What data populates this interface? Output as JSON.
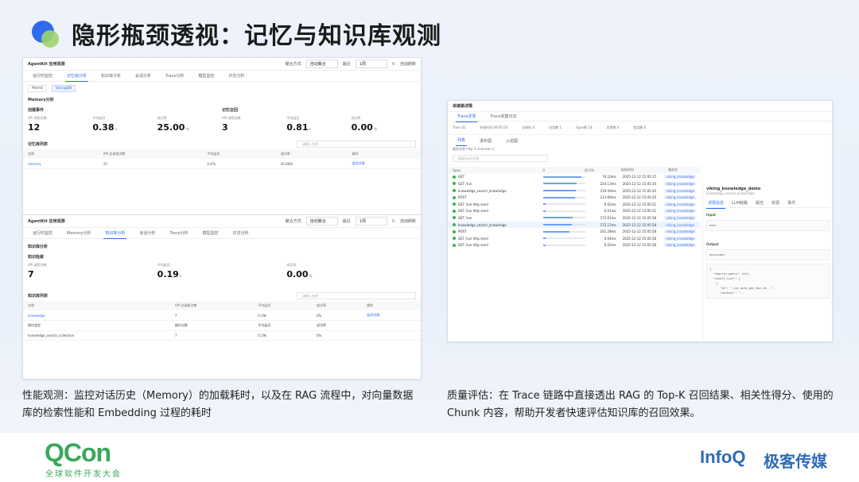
{
  "slide": {
    "title": "隐形瓶颈透视：记忆与知识库观测"
  },
  "panel1": {
    "app": "AgentKit 应用观测",
    "controls": {
      "agg_label": "聚合方式",
      "agg_value": "自动聚合",
      "range_label": "最近",
      "range_value": "1周",
      "refresh": "自动刷新"
    },
    "tabs": [
      "运行时监控",
      "记忆库分析",
      "知识库分析",
      "会话分析",
      "Trace分析",
      "模型监控",
      "日志分析"
    ],
    "subtabs": [
      "Mem0",
      "VikingDB"
    ],
    "section": "Memory分析",
    "groups": [
      {
        "title": "创建事件",
        "metrics": [
          {
            "label": "API 调用次数",
            "value": "12",
            "unit": ""
          },
          {
            "label": "平均延迟",
            "value": "0.38",
            "unit": "s"
          },
          {
            "label": "成功率",
            "value": "25.00",
            "unit": "%"
          }
        ]
      },
      {
        "title": "记忆召回",
        "metrics": [
          {
            "label": "API 调用次数",
            "value": "3",
            "unit": ""
          },
          {
            "label": "平均延迟",
            "value": "0.81",
            "unit": "s"
          },
          {
            "label": "成功率",
            "value": "0.00",
            "unit": "%"
          }
        ]
      }
    ],
    "list_title": "记忆库列表",
    "search_placeholder": "请输入名称",
    "table": {
      "headers": [
        "名称",
        "API 总调用次数",
        "平均延迟",
        "成功率",
        "操作"
      ],
      "rows": [
        [
          "memory",
          "15",
          "0.47s",
          "20.00%",
          "监控详情"
        ]
      ]
    }
  },
  "panel2": {
    "app": "AgentKit 应用观测",
    "controls": {
      "agg_label": "聚合方式",
      "agg_value": "自动聚合",
      "range_label": "最近",
      "range_value": "1周",
      "refresh": "自动刷新"
    },
    "tabs": [
      "运行时监控",
      "Memory分析",
      "知识库分析",
      "会话分析",
      "Trace分析",
      "模型监控",
      "日志分析"
    ],
    "section": "知识库分析",
    "group_title": "知识检索",
    "metrics": [
      {
        "label": "API 调用次数",
        "value": "7",
        "unit": ""
      },
      {
        "label": "平均延迟",
        "value": "0.19",
        "unit": "s"
      },
      {
        "label": "成功率",
        "value": "0.00",
        "unit": "%"
      }
    ],
    "list_title": "知识库列表",
    "search_placeholder": "请输入名称",
    "table": {
      "headers": [
        "名称",
        "API 总调用次数",
        "平均延迟",
        "成功率",
        "操作"
      ],
      "rows": [
        [
          "knowledge",
          "7",
          "0.19s",
          "0%",
          "监控详情"
        ],
        [
          "操作类型",
          "操作次数",
          "平均延迟",
          "成功率",
          ""
        ],
        [
          "knowledge_search_collection",
          "7",
          "0.19s",
          "0%",
          ""
        ]
      ]
    }
  },
  "panel3": {
    "title": "单链路详情",
    "tabs": [
      "Trace详情",
      "Trace完整日志"
    ],
    "info": [
      "Trace ID",
      "开始时间 08:00:50",
      "总耗时 4",
      "应用数 1",
      "Span数 18",
      "异常数 0",
      "错误数 0"
    ],
    "subtabs": [
      "列表",
      "瀑布图",
      "火焰图"
    ],
    "filters": "服务名称 http 3 unknown 2",
    "search_placeholder": "搜索Span名称",
    "header": [
      "Span",
      "0",
      "42.0%",
      "起始时间",
      "服务名"
    ],
    "rows": [
      {
        "name": "GET",
        "dur": "76.10ms",
        "ts": "2025-12-12 15:05:15",
        "svc": "viking_knowledge",
        "w": 0.9
      },
      {
        "name": "GET /run",
        "dur": "224.13ms",
        "ts": "2025-12-12 15:05:20",
        "svc": "viking_knowledge",
        "w": 0.8
      },
      {
        "name": "knowledge_search_knowledge",
        "dur": "219.59ms",
        "ts": "2025-12-12 15:05:20",
        "svc": "viking_knowledge",
        "w": 0.78
      },
      {
        "name": "POST",
        "dur": "213.69ms",
        "ts": "2025-12-12 15:05:20",
        "svc": "viking_knowledge",
        "w": 0.75
      },
      {
        "name": "GET /run http send",
        "dur": "0.02ms",
        "ts": "2025-12-12 15:05:21",
        "svc": "viking_knowledge",
        "w": 0.05
      },
      {
        "name": "GET /run http send",
        "dur": "0.01ms",
        "ts": "2025-12-12 15:05:21",
        "svc": "viking_knowledge",
        "w": 0.05
      },
      {
        "name": "GET /run",
        "dur": "172.61ms",
        "ts": "2025-12-12 15:05:58",
        "svc": "viking_knowledge",
        "w": 0.7
      },
      {
        "name": "knowledge_search_knowledge",
        "dur": "172.12ms",
        "ts": "2025-12-12 15:05:58",
        "svc": "viking_knowledge",
        "w": 0.68
      },
      {
        "name": "POST",
        "dur": "161.28ms",
        "ts": "2025-12-12 15:05:58",
        "svc": "viking_knowledge",
        "w": 0.62
      },
      {
        "name": "GET /run http send",
        "dur": "0.04ms",
        "ts": "2025-12-12 15:05:58",
        "svc": "viking_knowledge",
        "w": 0.05
      },
      {
        "name": "GET /run http send",
        "dur": "0.02ms",
        "ts": "2025-12-12 15:05:58",
        "svc": "viking_knowledge",
        "w": 0.05
      }
    ],
    "detail": {
      "title": "viking_knowledge_demo",
      "sub": "knowledge_search_knowledge",
      "tabs": [
        "详情信息",
        "LLM链路",
        "属性",
        "资源",
        "事件"
      ],
      "input": "Input",
      "output": "Output",
      "user": "user",
      "assistant": "assistant",
      "code": "{\n  \"rewrite_query\": null,\n  \"result_list\": [\n    {\n      \"id\": \"_sys_auto_gen_doc_id...\",\n      \"content\": \"..."
    }
  },
  "captions": {
    "left": "性能观测：监控对话历史（Memory）的加载耗时，以及在 RAG 流程中，对向量数据库的检索性能和 Embedding 过程的耗时",
    "right": "质量评估：在 Trace 链路中直接透出 RAG 的 Top-K 召回结果、相关性得分、使用的 Chunk 内容，帮助开发者快速评估知识库的召回效果。"
  },
  "footer": {
    "qcon": "QCon",
    "qcon_sub": "全球软件开发大会",
    "infoq": "InfoQ",
    "geek": "极客传媒"
  }
}
